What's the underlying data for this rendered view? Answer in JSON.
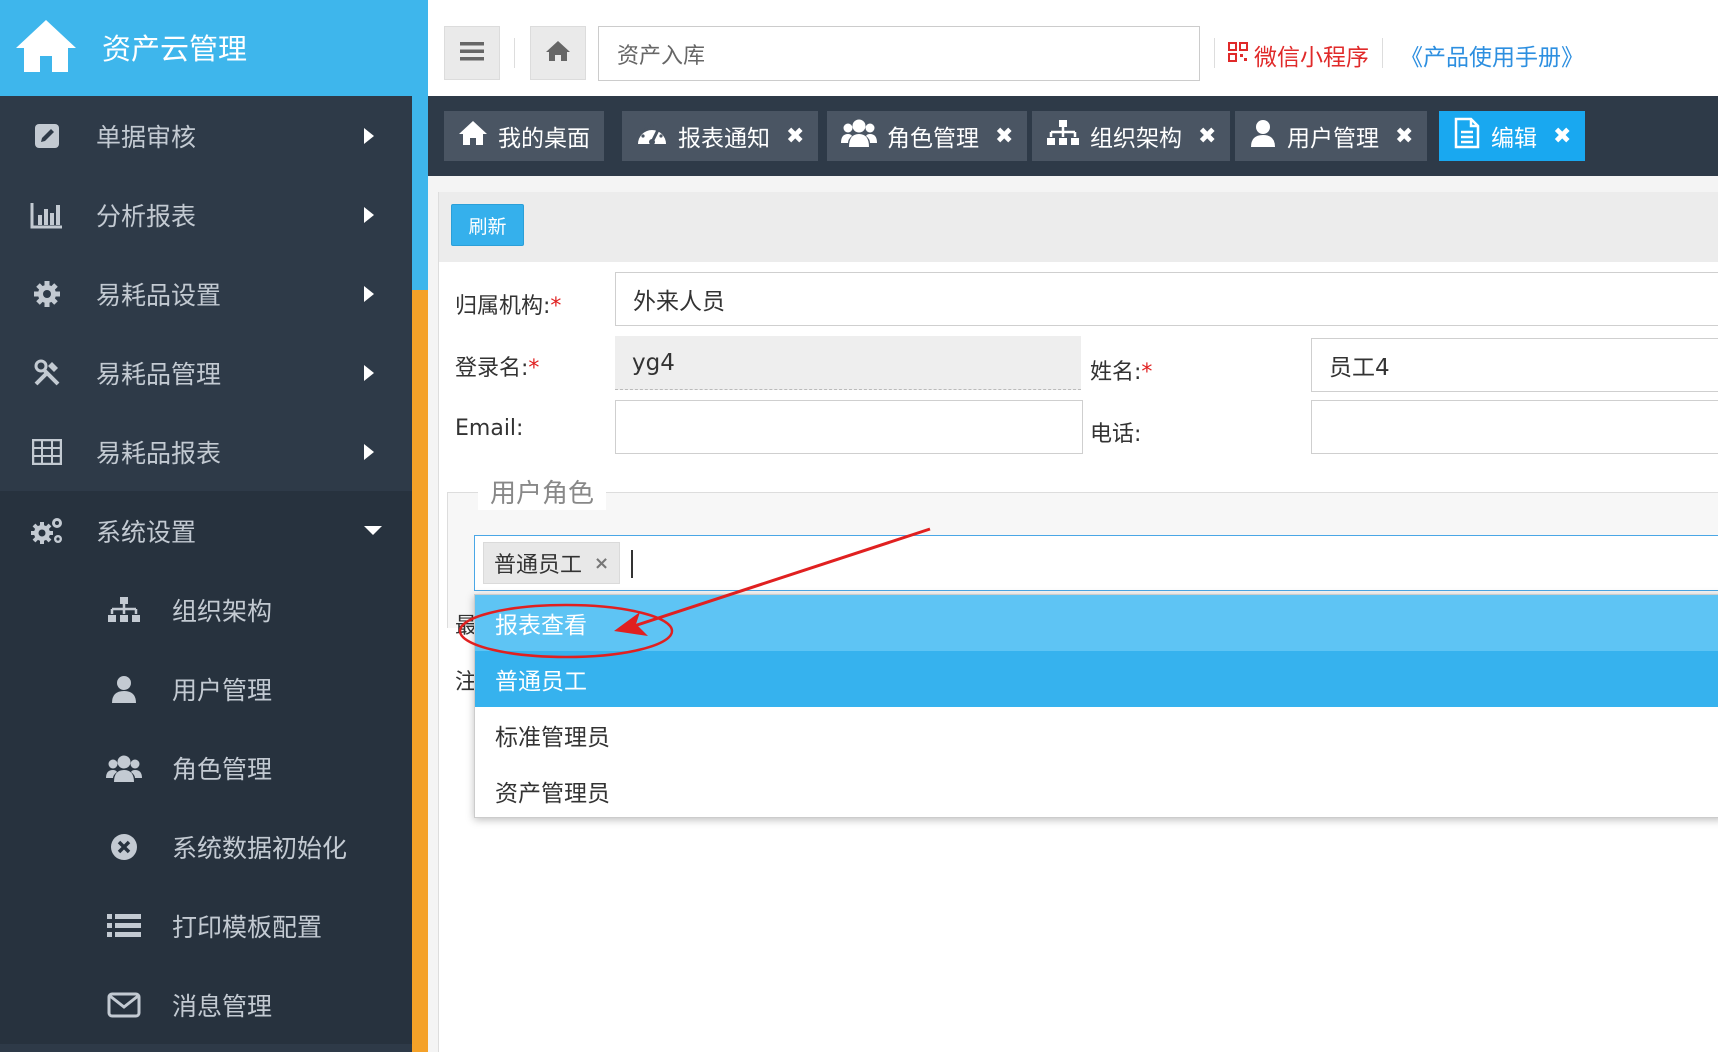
{
  "app": {
    "title": "资产云管理"
  },
  "sidebar": {
    "items": [
      {
        "label": "单据审核",
        "icon": "edit-icon"
      },
      {
        "label": "分析报表",
        "icon": "bar-chart-icon"
      },
      {
        "label": "易耗品设置",
        "icon": "gear-icon"
      },
      {
        "label": "易耗品管理",
        "icon": "tools-icon"
      },
      {
        "label": "易耗品报表",
        "icon": "table-icon"
      },
      {
        "label": "系统设置",
        "icon": "gears-icon"
      }
    ],
    "subitems": [
      {
        "label": "组织架构",
        "icon": "sitemap-icon"
      },
      {
        "label": "用户管理",
        "icon": "user-icon"
      },
      {
        "label": "角色管理",
        "icon": "users-icon"
      },
      {
        "label": "系统数据初始化",
        "icon": "circle-x-icon"
      },
      {
        "label": "打印模板配置",
        "icon": "list-icon"
      },
      {
        "label": "消息管理",
        "icon": "envelope-icon"
      }
    ]
  },
  "topbar": {
    "search_value": "资产入库",
    "mini_program": "微信小程序",
    "manual": "《产品使用手册》"
  },
  "tabs": [
    {
      "label": "我的桌面",
      "icon": "home-icon",
      "closable": false
    },
    {
      "label": "报表通知",
      "icon": "dashboard-icon",
      "closable": true
    },
    {
      "label": "角色管理",
      "icon": "users-icon",
      "closable": true
    },
    {
      "label": "组织架构",
      "icon": "sitemap-icon",
      "closable": true
    },
    {
      "label": "用户管理",
      "icon": "user-icon",
      "closable": true
    },
    {
      "label": "编辑",
      "icon": "file-icon",
      "closable": true,
      "active": true
    }
  ],
  "close_glyph": "✖",
  "required_mark": "*",
  "form": {
    "refresh": "刷新",
    "org_label": "归属机构:",
    "org_value": "外来人员",
    "login_label": "登录名:",
    "login_value": "yg4",
    "name_label": "姓名:",
    "name_value": "员工4",
    "email_label": "Email:",
    "email_value": "",
    "phone_label": "电话:",
    "phone_value": "",
    "roles_legend": "用户角色",
    "selected_role": "普通员工",
    "chip_remove": "×",
    "partial_label_1": "最",
    "partial_label_2": "注"
  },
  "dropdown": {
    "options": [
      "报表查看",
      "普通员工",
      "标准管理员",
      "资产管理员"
    ],
    "hover_index": 0,
    "selected_index": 1
  },
  "colors": {
    "sidebar": "#2e3a48",
    "brand": "#3eb6ec",
    "accent": "#19a8f0",
    "orange": "#f4a128",
    "annotation": "#e02020"
  }
}
